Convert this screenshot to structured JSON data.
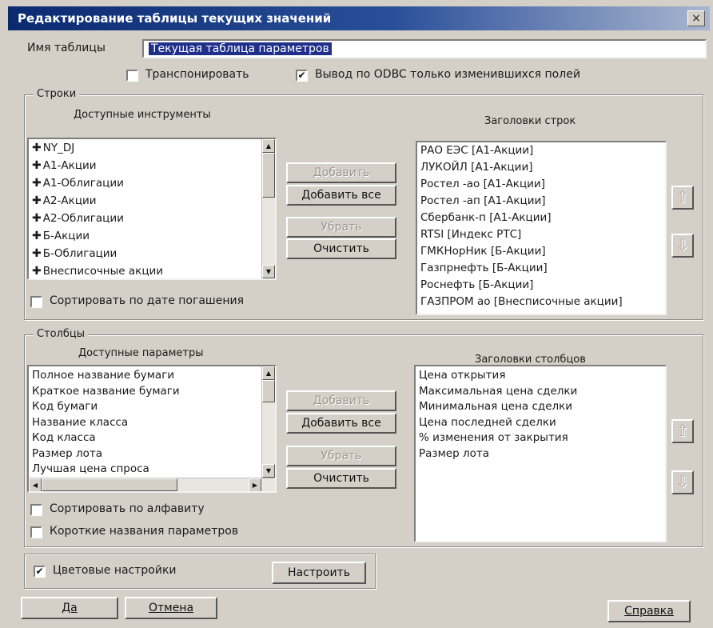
{
  "title": "Редактирование таблицы текущих значений",
  "close_glyph": "×",
  "table_name": {
    "label": "Имя таблицы",
    "value": "Текущая таблица параметров"
  },
  "transpose": {
    "label": "Транспонировать",
    "checked": false
  },
  "odbc": {
    "label": "Вывод по ODBC только изменившихся полей",
    "checked": true
  },
  "rows": {
    "group_title": "Строки",
    "available_title": "Доступные инструменты",
    "available_items": [
      "NY_DJ",
      "А1-Акции",
      "А1-Облигации",
      "А2-Акции",
      "А2-Облигации",
      "Б-Акции",
      "Б-Облигации",
      "Внесписочные акции"
    ],
    "selected_title": "Заголовки строк",
    "selected_items": [
      "РАО ЕЭС [А1-Акции]",
      "ЛУКОЙЛ [А1-Акции]",
      "Ростел -ао [А1-Акции]",
      "Ростел -ап [А1-Акции]",
      "Сбербанк-п [А1-Акции]",
      "RTSI [Индекс РТС]",
      "ГМКНорНик [Б-Акции]",
      "Газпрнефть [Б-Акции]",
      "Роснефть [Б-Акции]",
      "ГАЗПРОМ ао [Внесписочные акции]"
    ],
    "sort_label": "Сортировать по дате погашения",
    "sort_checked": false
  },
  "columns": {
    "group_title": "Столбцы",
    "available_title": "Доступные параметры",
    "available_items": [
      "Полное название бумаги",
      "Краткое название бумаги",
      "Код бумаги",
      "Название класса",
      "Код класса",
      "Размер лота",
      "Лучшая цена спроса"
    ],
    "selected_title": "Заголовки столбцов",
    "selected_items": [
      "Цена открытия",
      "Максимальная цена сделки",
      "Минимальная цена сделки",
      "Цена последней сделки",
      "% изменения от закрытия",
      "Размер лота"
    ],
    "sort_alpha_label": "Сортировать по алфавиту",
    "short_names_label": "Короткие названия параметров"
  },
  "buttons": {
    "add": "Добавить",
    "add_all": "Добавить все",
    "remove": "Убрать",
    "clear": "Очистить",
    "configure": "Настроить",
    "ok": "Да",
    "cancel": "Отмена",
    "help": "Справка"
  },
  "color_settings": {
    "label": "Цветовые настройки",
    "checked": true
  },
  "icons": {
    "check": "✔",
    "up": "⇧",
    "down": "⇩",
    "scroll_up": "▲",
    "scroll_down": "▼",
    "scroll_left": "◀",
    "scroll_right": "▶",
    "plus": "✚"
  }
}
